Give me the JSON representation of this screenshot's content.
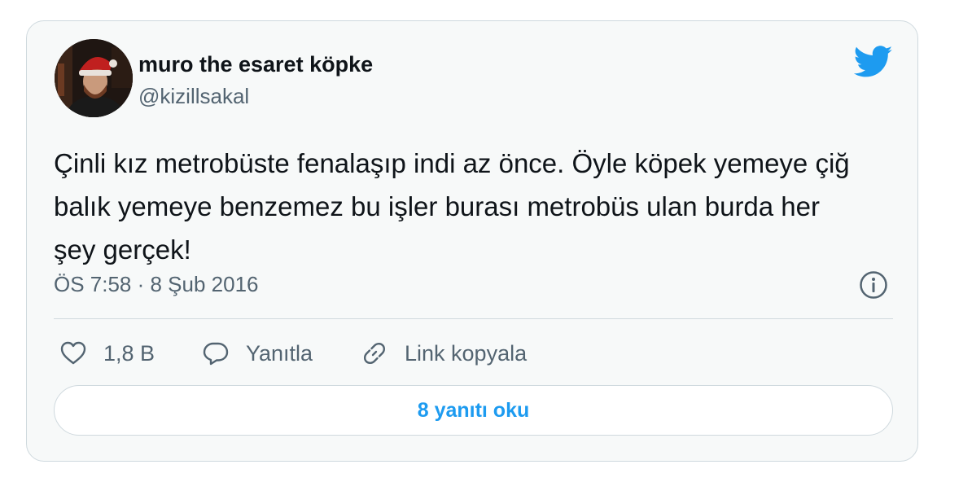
{
  "user": {
    "display_name": "muro the esaret köpke",
    "handle": "@kizillsakal",
    "avatar_icon": "profile-photo-santa-hat"
  },
  "tweet": {
    "text": "Çinli kız metrobüste fenalaşıp indi az önce. Öyle köpek yemeye çiğ balık yemeye benzemez bu işler burası metrobüs ulan burda her şey gerçek!",
    "timestamp": "ÖS 7:58 · 8 Şub 2016"
  },
  "actions": {
    "like_count": "1,8 B",
    "reply_label": "Yanıtla",
    "copy_link_label": "Link kopyala"
  },
  "read_replies_label": "8 yanıtı oku",
  "icons": {
    "brand": "twitter-bird-icon",
    "info": "info-icon",
    "like": "heart-icon",
    "reply": "speech-bubble-icon",
    "copy": "link-icon"
  },
  "colors": {
    "brand": "#1d9bf0",
    "text": "#0f1419",
    "secondary": "#536471",
    "border": "#cfd9de",
    "card_background": "#f7f9f9"
  }
}
